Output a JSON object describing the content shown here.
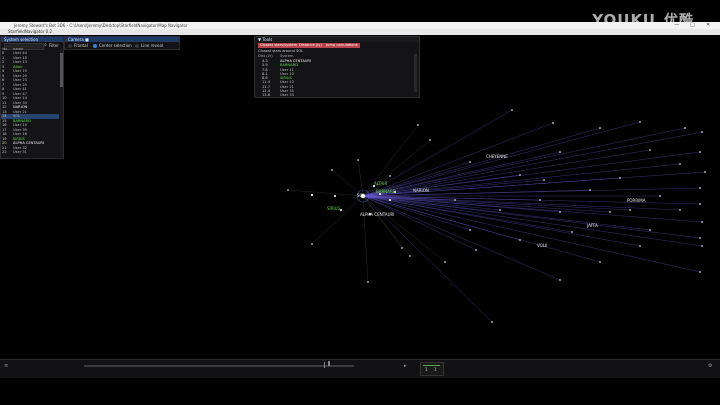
{
  "window": {
    "title": "Jeremy Stewart's Bot 3D6 - C:\\Users\\Jeremy\\Desktop\\StarfieldNavigator\\Map Navigator",
    "app_title": "StarfieldNavigator 0.2",
    "controls": [
      "—",
      "□",
      "✕"
    ]
  },
  "watermark": {
    "text": "YOUKU",
    "cn": "优酷"
  },
  "system_selection": {
    "title": "System selection",
    "filter_label": "Filter",
    "columns": {
      "id": "idx",
      "name": "name"
    },
    "rows": [
      {
        "id": "0",
        "name": "User 44",
        "style": "normal"
      },
      {
        "id": "1",
        "name": "User 18",
        "style": "normal"
      },
      {
        "id": "2",
        "name": "User 13",
        "style": "normal"
      },
      {
        "id": "3",
        "name": "Altair",
        "style": "green"
      },
      {
        "id": "4",
        "name": "User 19",
        "style": "normal"
      },
      {
        "id": "5",
        "name": "User 20",
        "style": "normal"
      },
      {
        "id": "6",
        "name": "User 23",
        "style": "normal"
      },
      {
        "id": "7",
        "name": "User 25",
        "style": "normal"
      },
      {
        "id": "8",
        "name": "User 41",
        "style": "normal"
      },
      {
        "id": "9",
        "name": "User 47",
        "style": "normal"
      },
      {
        "id": "10",
        "name": "User 14",
        "style": "normal"
      },
      {
        "id": "11",
        "name": "User 34",
        "style": "normal"
      },
      {
        "id": "12",
        "name": "NARION",
        "style": "white"
      },
      {
        "id": "13",
        "name": "User 21",
        "style": "normal"
      },
      {
        "id": "14",
        "name": "SOL",
        "style": "selected"
      },
      {
        "id": "15",
        "name": "BARNARD",
        "style": "green"
      },
      {
        "id": "16",
        "name": "User 15",
        "style": "normal"
      },
      {
        "id": "17",
        "name": "User 39",
        "style": "normal"
      },
      {
        "id": "18",
        "name": "User 16",
        "style": "normal"
      },
      {
        "id": "19",
        "name": "SIRIUS",
        "style": "green"
      },
      {
        "id": "20",
        "name": "ALPHA CENTAURI",
        "style": "white"
      },
      {
        "id": "21",
        "name": "User 32",
        "style": "normal"
      },
      {
        "id": "22",
        "name": "User 31",
        "style": "normal"
      }
    ]
  },
  "camera": {
    "title": "Camera",
    "options": [
      {
        "label": "Frontal",
        "selected": false
      },
      {
        "label": "Center selection",
        "selected": true
      },
      {
        "label": "Line reveal",
        "selected": false
      }
    ]
  },
  "tools": {
    "title": "Tools",
    "buttons": [
      "Closest stars/systems",
      "Distance (ly)",
      "Jump calculations"
    ],
    "subtitle": "Closest stars around SOL",
    "columns": {
      "dist": "Dist (LY)",
      "name": "System"
    },
    "rows": [
      {
        "dist": "4.3",
        "name": "ALPHA CENTAURI",
        "style": "white"
      },
      {
        "dist": "5.9",
        "name": "BARNARD",
        "style": "green"
      },
      {
        "dist": "7.8",
        "name": "User 11",
        "style": "normal"
      },
      {
        "dist": "8.1",
        "name": "User 10",
        "style": "normal"
      },
      {
        "dist": "8.6",
        "name": "SIRIUS",
        "style": "green"
      },
      {
        "dist": "11.4",
        "name": "User 10",
        "style": "normal"
      },
      {
        "dist": "11.7",
        "name": "User 21",
        "style": "normal"
      },
      {
        "dist": "12.4",
        "name": "User 35",
        "style": "normal"
      },
      {
        "dist": "13.6",
        "name": "User 33",
        "style": "normal"
      }
    ]
  },
  "map_labels": [
    {
      "text": "ALTAIR",
      "color": "green"
    },
    {
      "text": "BARNARD",
      "color": "green"
    },
    {
      "text": "SIRIUS",
      "color": "green"
    },
    {
      "text": "SOL",
      "color": "white"
    },
    {
      "text": "NARION",
      "color": "white"
    },
    {
      "text": "ALPHA CENTAURI",
      "color": "white"
    },
    {
      "text": "CHEYENNE",
      "color": "white"
    },
    {
      "text": "PORRIMA",
      "color": "white"
    },
    {
      "text": "JAFFA",
      "color": "white"
    },
    {
      "text": "VOLII",
      "color": "white"
    }
  ],
  "colors": {
    "accent": "#3d7fd6",
    "green_label": "#6bdc48",
    "button_red": "#b8434a",
    "line_blue": "#6a5ad6"
  },
  "bottom": {
    "mini_values": [
      "1",
      "1"
    ]
  }
}
